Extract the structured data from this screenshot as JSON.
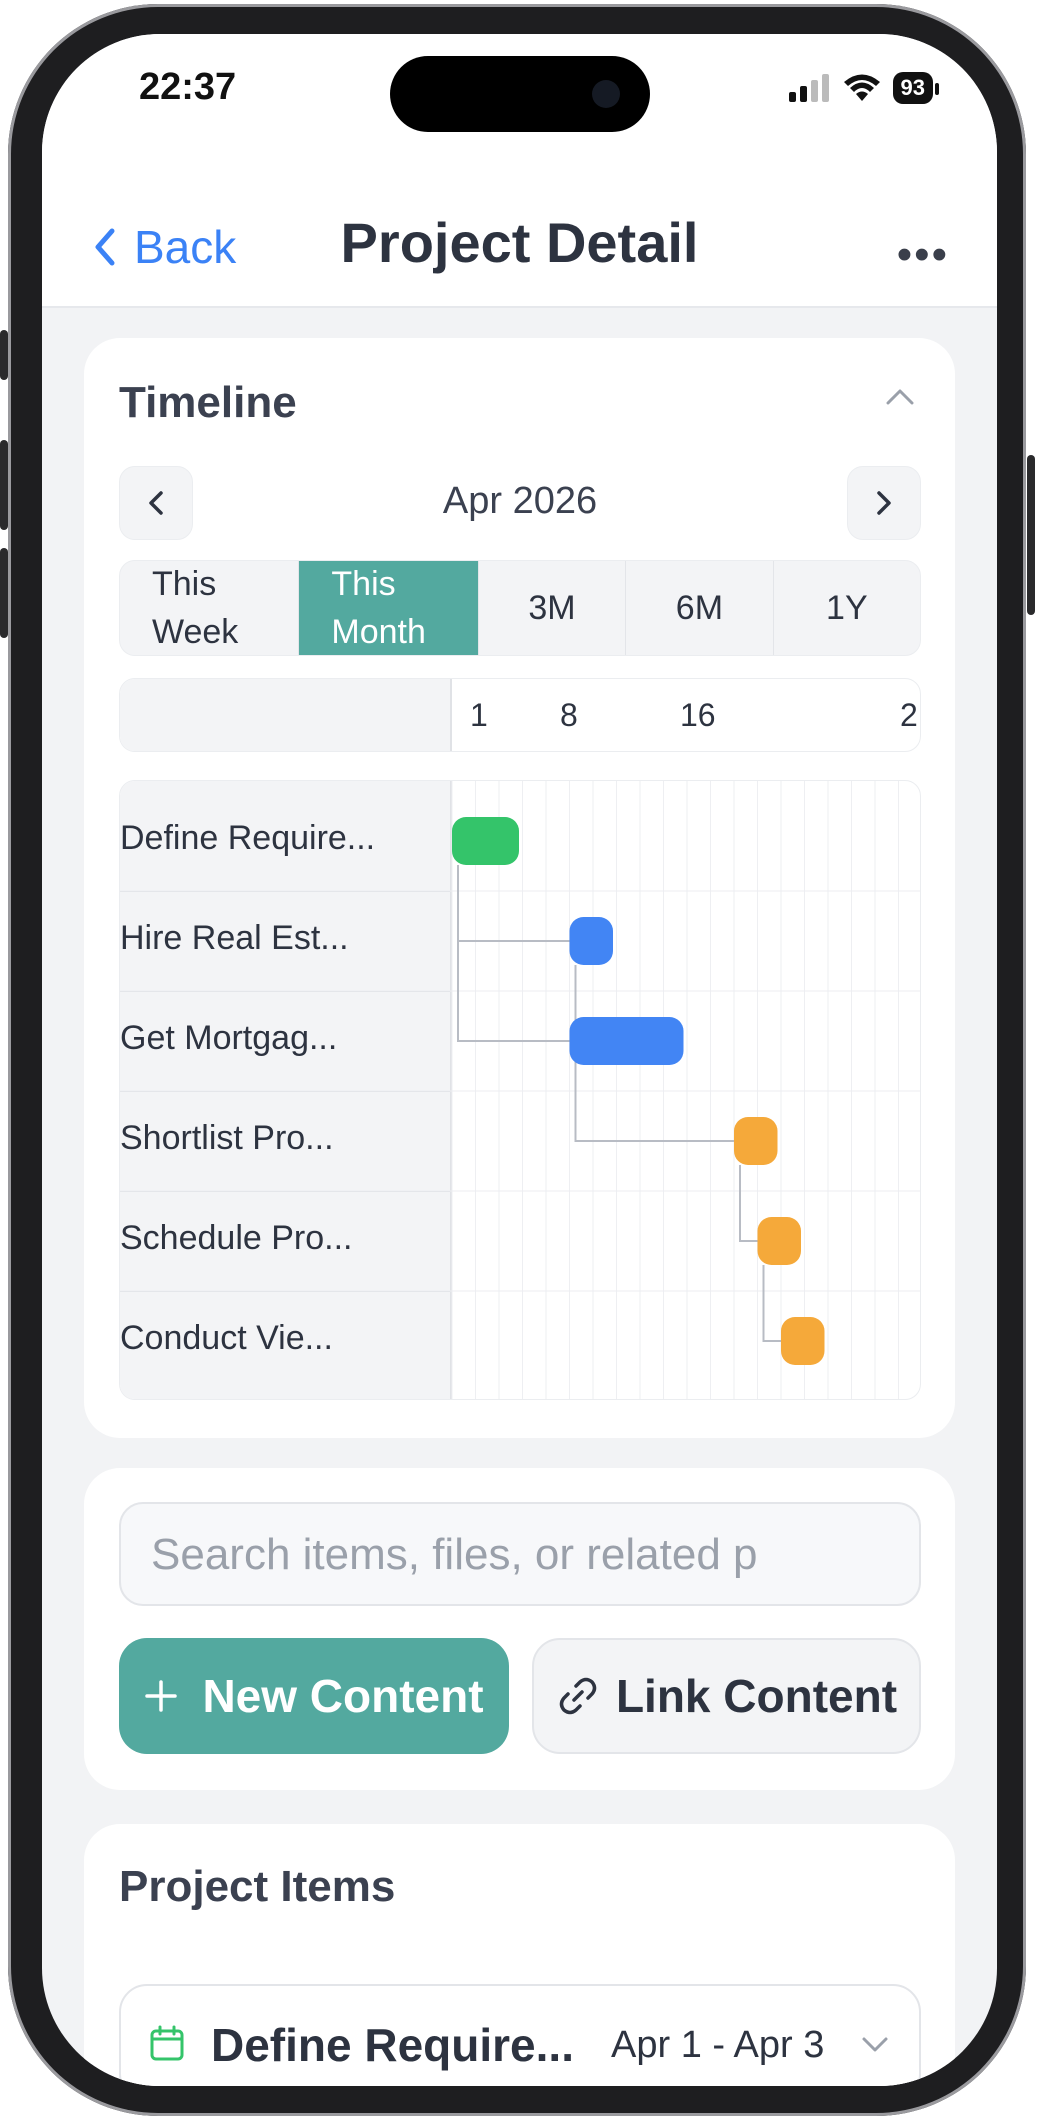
{
  "status": {
    "time": "22:37",
    "battery": "93"
  },
  "nav": {
    "back_label": "Back",
    "title": "Project Detail",
    "more_label": "•••"
  },
  "timeline": {
    "title": "Timeline",
    "month": "Apr 2026",
    "segments": [
      {
        "line1": "This",
        "line2": "Week"
      },
      {
        "line1": "This",
        "line2": "Month"
      },
      {
        "label": "3M"
      },
      {
        "label": "6M"
      },
      {
        "label": "1Y"
      }
    ],
    "active_segment": 1,
    "ticks": [
      "1",
      "8",
      "16",
      "2"
    ]
  },
  "chart_data": {
    "type": "gantt",
    "x_range_days": [
      1,
      23
    ],
    "tasks": [
      {
        "label": "Define Require...",
        "start": 1,
        "end": 3,
        "color": "#34c46a"
      },
      {
        "label": "Hire Real Est...",
        "start": 6,
        "end": 7,
        "color": "#4285f4"
      },
      {
        "label": "Get Mortgag...",
        "start": 6,
        "end": 10,
        "color": "#4285f4"
      },
      {
        "label": "Shortlist Pro...",
        "start": 13,
        "end": 14,
        "color": "#f5a93a"
      },
      {
        "label": "Schedule Pro...",
        "start": 14,
        "end": 15,
        "color": "#f5a93a"
      },
      {
        "label": "Conduct Vie...",
        "start": 15,
        "end": 16,
        "color": "#f5a93a"
      }
    ],
    "dependencies": [
      [
        0,
        1
      ],
      [
        0,
        2
      ],
      [
        1,
        3
      ],
      [
        3,
        4
      ],
      [
        4,
        5
      ]
    ]
  },
  "actions": {
    "search_placeholder": "Search items, files, or related p",
    "new_content": "New Content",
    "link_content": "Link Content"
  },
  "project_items": {
    "title": "Project Items",
    "items": [
      {
        "name": "Define Require...",
        "dates": "Apr 1 - Apr 3"
      }
    ]
  }
}
